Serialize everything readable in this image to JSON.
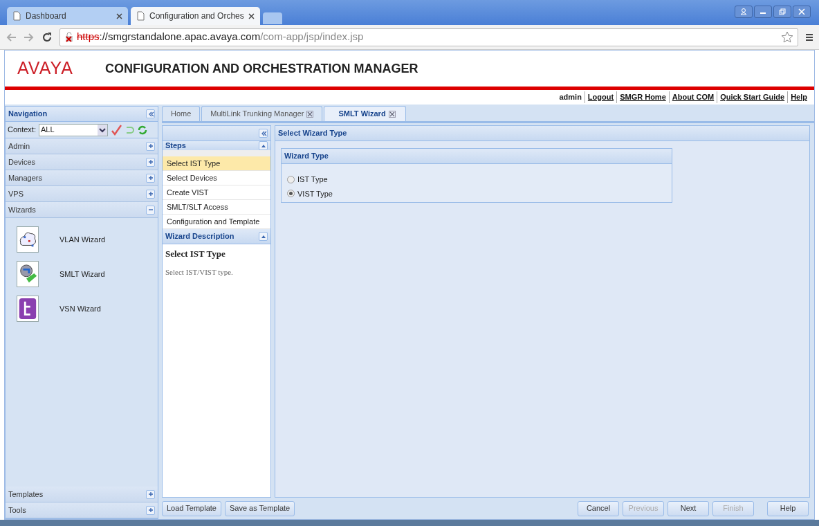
{
  "browser": {
    "tabs": [
      {
        "title": "Dashboard",
        "selected": false
      },
      {
        "title": "Configuration and Orches",
        "selected": true
      }
    ],
    "address": {
      "scheme": "https",
      "host": "://smgrstandalone.apac.avaya.com",
      "path": "/com-app/jsp/index.jsp",
      "insecure": true
    }
  },
  "header": {
    "logo": "AVAYA",
    "title": "CONFIGURATION AND ORCHESTRATION MANAGER",
    "user": "admin",
    "links": [
      "Logout",
      "SMGR Home",
      "About COM",
      "Quick Start Guide",
      "Help"
    ]
  },
  "navigation": {
    "title": "Navigation",
    "context_label": "Context:",
    "context_value": "ALL",
    "sections": [
      {
        "label": "Admin",
        "expanded": false
      },
      {
        "label": "Devices",
        "expanded": false
      },
      {
        "label": "Managers",
        "expanded": false
      },
      {
        "label": "VPS",
        "expanded": false
      },
      {
        "label": "Wizards",
        "expanded": true
      }
    ],
    "wizards": [
      {
        "label": "VLAN Wizard",
        "kind": "vlan"
      },
      {
        "label": "SMLT Wizard",
        "kind": "smlt"
      },
      {
        "label": "VSN Wizard",
        "kind": "vsn"
      }
    ],
    "bottom_sections": [
      {
        "label": "Templates",
        "expanded": false
      },
      {
        "label": "Tools",
        "expanded": false
      }
    ]
  },
  "content_tabs": [
    {
      "label": "Home",
      "selected": false,
      "closable": false
    },
    {
      "label": "MultiLink Trunking Manager",
      "selected": false,
      "closable": true
    },
    {
      "label": "SMLT Wizard",
      "selected": true,
      "closable": true
    }
  ],
  "steps": {
    "title": "Steps",
    "items": [
      {
        "label": "Select IST Type",
        "selected": true
      },
      {
        "label": "Select Devices",
        "selected": false
      },
      {
        "label": "Create VIST",
        "selected": false
      },
      {
        "label": "SMLT/SLT Access",
        "selected": false
      },
      {
        "label": "Configuration and Template",
        "selected": false
      }
    ],
    "description_title": "Wizard Description",
    "description_heading": "Select IST Type",
    "description_text": "Select IST/VIST type."
  },
  "main": {
    "title": "Select Wizard Type",
    "group_title": "Wizard Type",
    "options": [
      {
        "label": "IST Type",
        "selected": false
      },
      {
        "label": "VIST Type",
        "selected": true
      }
    ]
  },
  "template_buttons": [
    "Load Template",
    "Save as Template"
  ],
  "wizard_buttons": [
    {
      "label": "Cancel",
      "disabled": false
    },
    {
      "label": "Previous",
      "disabled": true
    },
    {
      "label": "Next",
      "disabled": false
    },
    {
      "label": "Finish",
      "disabled": true
    },
    {
      "label": "Help",
      "disabled": false
    }
  ]
}
